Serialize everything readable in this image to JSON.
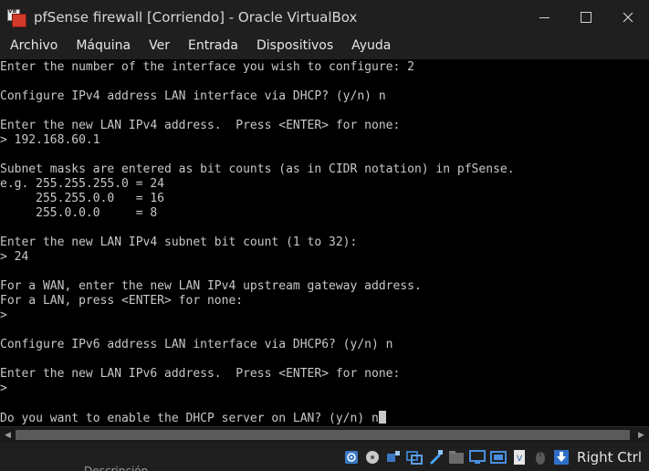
{
  "window": {
    "title": "pfSense firewall [Corriendo] - Oracle VirtualBox",
    "icon_label": "VB"
  },
  "menu": {
    "items": [
      "Archivo",
      "Máquina",
      "Ver",
      "Entrada",
      "Dispositivos",
      "Ayuda"
    ]
  },
  "console": {
    "lines": [
      "Enter the number of the interface you wish to configure: 2",
      "",
      "Configure IPv4 address LAN interface via DHCP? (y/n) n",
      "",
      "Enter the new LAN IPv4 address.  Press <ENTER> for none:",
      "> 192.168.60.1",
      "",
      "Subnet masks are entered as bit counts (as in CIDR notation) in pfSense.",
      "e.g. 255.255.255.0 = 24",
      "     255.255.0.0   = 16",
      "     255.0.0.0     = 8",
      "",
      "Enter the new LAN IPv4 subnet bit count (1 to 32):",
      "> 24",
      "",
      "For a WAN, enter the new LAN IPv4 upstream gateway address.",
      "For a LAN, press <ENTER> for none:",
      ">",
      "",
      "Configure IPv6 address LAN interface via DHCP6? (y/n) n",
      "",
      "Enter the new LAN IPv6 address.  Press <ENTER> for none:",
      ">",
      "",
      "Do you want to enable the DHCP server on LAN? (y/n) n"
    ]
  },
  "statusbar": {
    "host_key": "Right Ctrl",
    "icons": [
      "hard-disk-icon",
      "optical-drive-icon",
      "audio-icon",
      "network-icon",
      "usb-icon",
      "shared-folders-icon",
      "display-icon",
      "recording-icon",
      "cpu-icon",
      "mouse-integration-icon",
      "host-key-arrow-icon"
    ]
  },
  "background_peek": "Descripción",
  "colors": {
    "chrome_bg": "#1f1f1f",
    "console_bg": "#000000",
    "console_fg": "#c8c8c8",
    "vbox_red": "#d33a2c"
  }
}
